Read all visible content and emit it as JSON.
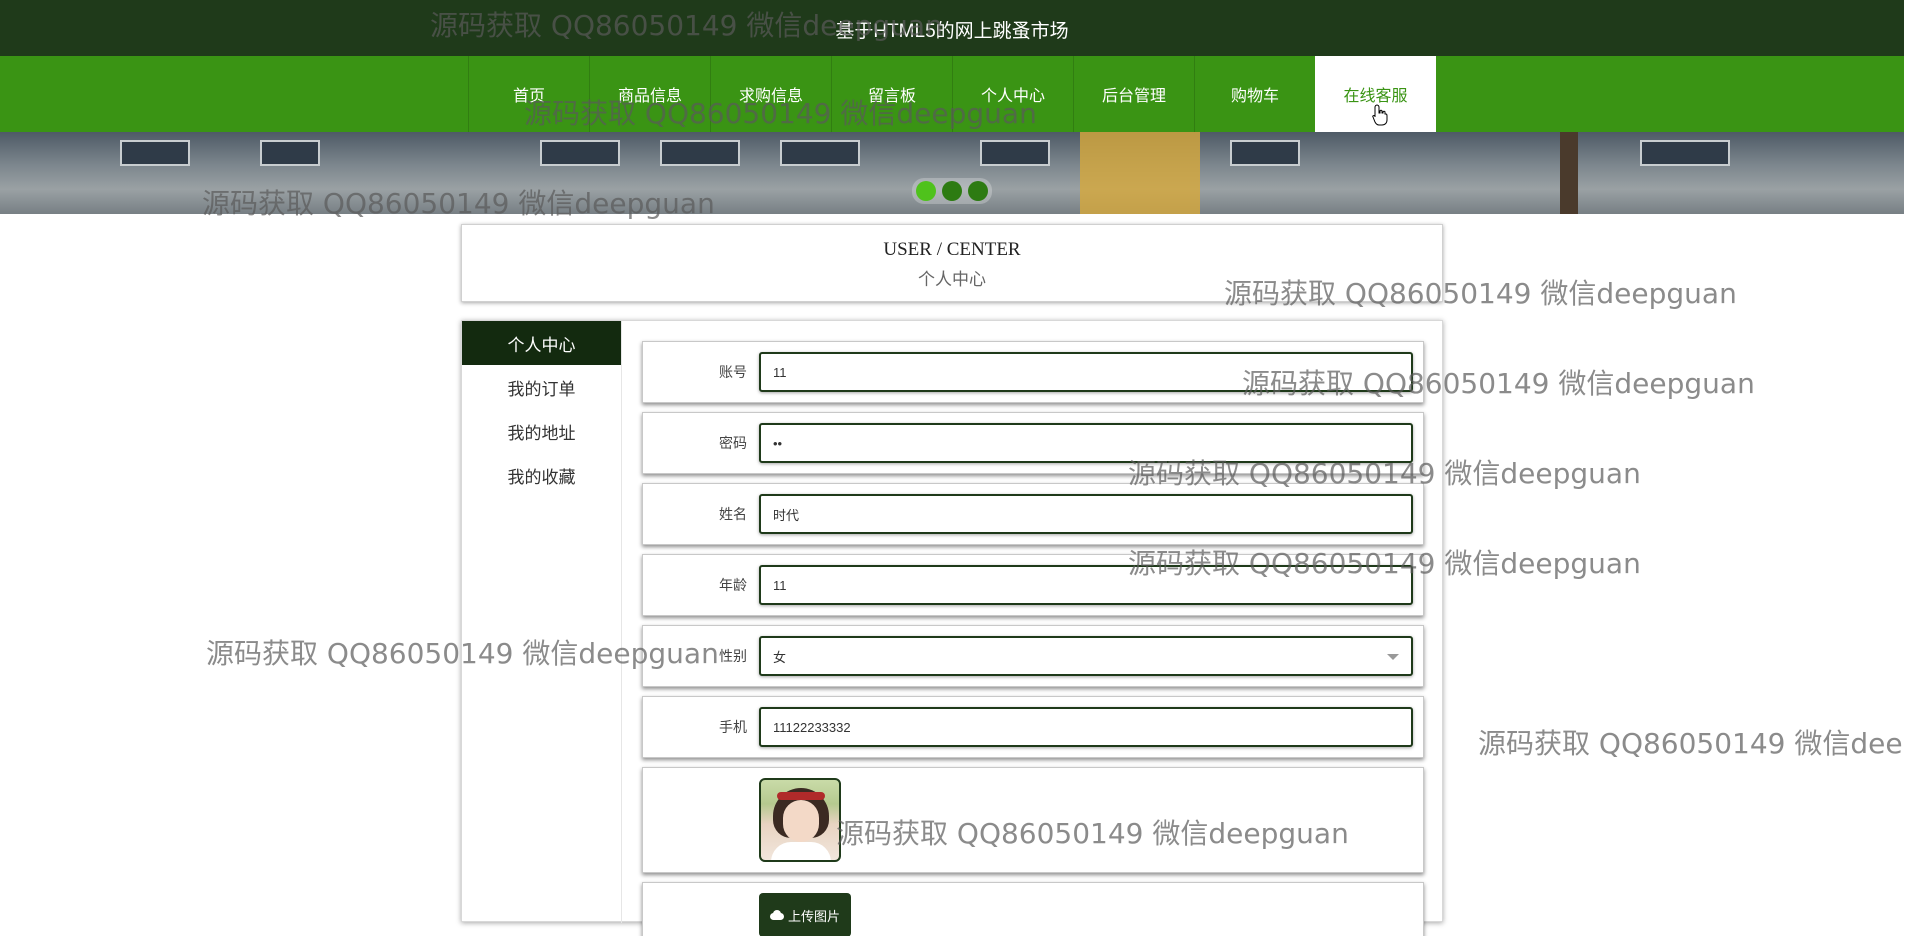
{
  "site": {
    "title": "基于HTML5的网上跳蚤市场"
  },
  "nav": {
    "items": [
      {
        "label": "首页",
        "active": false
      },
      {
        "label": "商品信息",
        "active": false
      },
      {
        "label": "求购信息",
        "active": false
      },
      {
        "label": "留言板",
        "active": false
      },
      {
        "label": "个人中心",
        "active": false
      },
      {
        "label": "后台管理",
        "active": false
      },
      {
        "label": "购物车",
        "active": false
      },
      {
        "label": "在线客服",
        "active": true
      }
    ]
  },
  "carousel": {
    "dot_count": 3,
    "active_index": 0
  },
  "heading": {
    "en": "USER / CENTER",
    "zh": "个人中心"
  },
  "sidebar": {
    "items": [
      {
        "label": "个人中心",
        "active": true
      },
      {
        "label": "我的订单",
        "active": false
      },
      {
        "label": "我的地址",
        "active": false
      },
      {
        "label": "我的收藏",
        "active": false
      }
    ]
  },
  "form": {
    "account": {
      "label": "账号",
      "value": "11"
    },
    "password": {
      "label": "密码",
      "value": "••"
    },
    "name": {
      "label": "姓名",
      "value": "时代"
    },
    "age": {
      "label": "年龄",
      "value": "11"
    },
    "gender": {
      "label": "性别",
      "value": "女"
    },
    "phone": {
      "label": "手机",
      "value": "11122233332"
    },
    "upload": {
      "label": "上传图片",
      "icon": "cloud-upload-icon"
    }
  },
  "watermark": {
    "text": "源码获取 QQ86050149 微信deepguan"
  },
  "colors": {
    "topbar": "#1f3a1a",
    "nav": "#3a9414",
    "accent_dark": "#132a0f"
  }
}
